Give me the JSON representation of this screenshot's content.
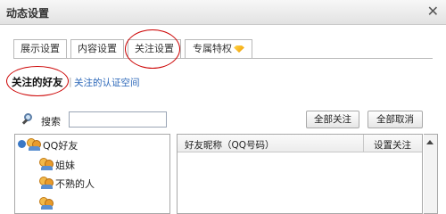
{
  "window": {
    "title": "动态设置",
    "close_glyph": "✕"
  },
  "tabs": [
    {
      "label": "展示设置"
    },
    {
      "label": "内容设置"
    },
    {
      "label": "关注设置",
      "active": true
    },
    {
      "label": "专属特权"
    }
  ],
  "subnav": {
    "current": "关注的好友",
    "link": "关注的认证空间"
  },
  "search": {
    "label": "搜索",
    "value": ""
  },
  "buttons": {
    "follow_all": "全部关注",
    "cancel_all": "全部取消"
  },
  "tree": {
    "root": "QQ好友",
    "children": [
      "姐妹",
      "不熟的人",
      ""
    ]
  },
  "friends_table": {
    "columns": [
      "好友昵称（QQ号码）",
      "设置关注"
    ],
    "rows": []
  },
  "colors": {
    "link": "#2a66b8",
    "annotation_circle": "#cc0000",
    "expander": "#3a78c5"
  }
}
